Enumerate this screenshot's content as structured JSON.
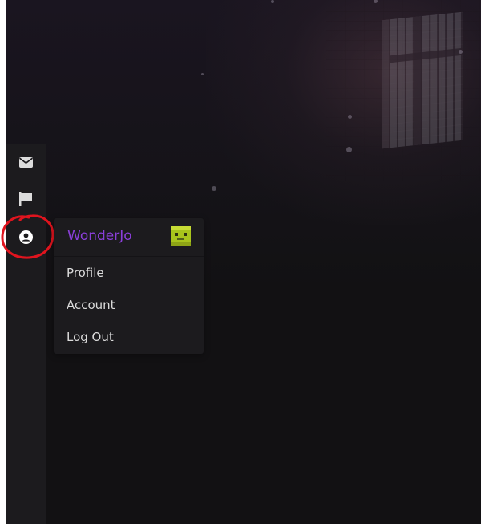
{
  "sidebar": {
    "items": [
      {
        "icon": "envelope-icon"
      },
      {
        "icon": "flag-icon"
      },
      {
        "icon": "user-circle-icon"
      }
    ]
  },
  "user_menu": {
    "username": "WonderJo",
    "username_color": "#8a3fd9",
    "avatar": "green-block-avatar",
    "items": [
      {
        "label": "Profile"
      },
      {
        "label": "Account"
      },
      {
        "label": "Log Out"
      }
    ]
  },
  "annotation": {
    "type": "hand-drawn-circle",
    "color": "#e0141e",
    "target": "user-circle-icon"
  }
}
